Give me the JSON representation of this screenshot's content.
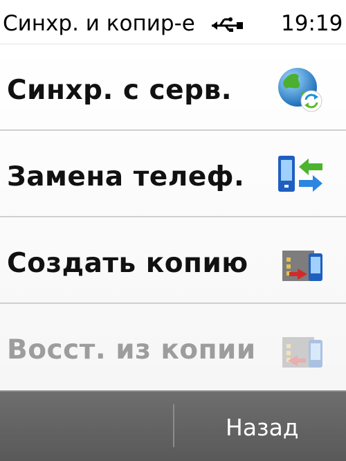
{
  "status_bar": {
    "title": "Синхр. и копир-е",
    "time": "19:19",
    "connection_icon": "usb-icon"
  },
  "menu": {
    "items": [
      {
        "label": "Синхр. с серв.",
        "icon": "globe-sync-icon",
        "enabled": true
      },
      {
        "label": "Замена телеф.",
        "icon": "phone-transfer-icon",
        "enabled": true
      },
      {
        "label": "Создать копию",
        "icon": "backup-create-icon",
        "enabled": true
      },
      {
        "label": "Восст. из копии",
        "icon": "backup-restore-icon",
        "enabled": false
      }
    ]
  },
  "softkeys": {
    "left_label": "",
    "right_label": "Назад"
  },
  "colors": {
    "softkey_bar": "#5f5f5f",
    "disabled_text": "#9d9d9d"
  }
}
